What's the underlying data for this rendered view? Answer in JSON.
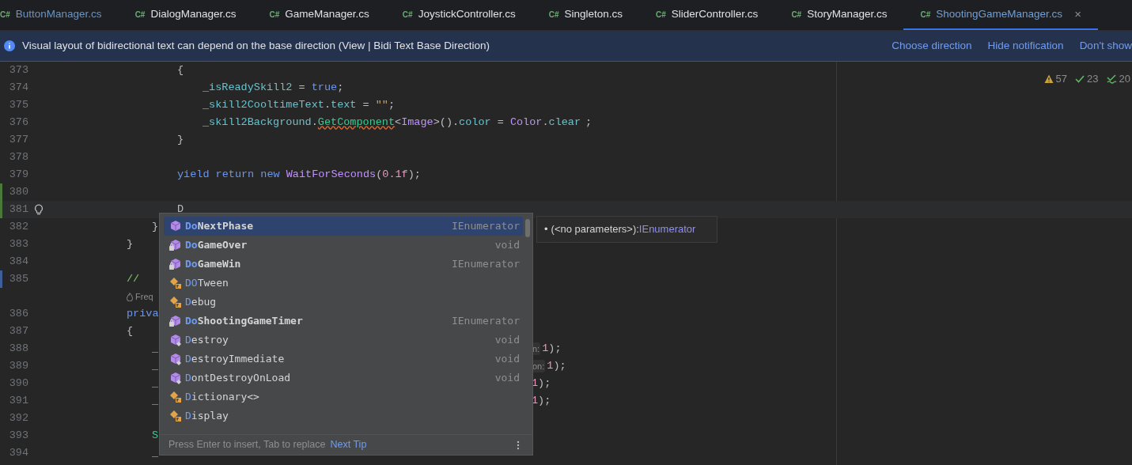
{
  "tabs": [
    {
      "lang": "C#",
      "label": "ButtonManager.cs",
      "color": "#6b93c4",
      "selected": false
    },
    {
      "lang": "C#",
      "label": "DialogManager.cs",
      "color": "#dfe1e5",
      "selected": false
    },
    {
      "lang": "C#",
      "label": "GameManager.cs",
      "color": "#dfe1e5",
      "selected": false
    },
    {
      "lang": "C#",
      "label": "JoystickController.cs",
      "color": "#dfe1e5",
      "selected": false
    },
    {
      "lang": "C#",
      "label": "Singleton.cs",
      "color": "#dfe1e5",
      "selected": false
    },
    {
      "lang": "C#",
      "label": "SliderController.cs",
      "color": "#dfe1e5",
      "selected": false
    },
    {
      "lang": "C#",
      "label": "StoryManager.cs",
      "color": "#dfe1e5",
      "selected": false
    },
    {
      "lang": "C#",
      "label": "ShootingGameManager.cs",
      "color": "#6f9fd6",
      "selected": true,
      "close": "×"
    }
  ],
  "notification": {
    "message": "Visual layout of bidirectional text can depend on the base direction (View | Bidi Text Base Direction)",
    "actions": [
      "Choose direction",
      "Hide notification",
      "Don't show"
    ]
  },
  "inspections": [
    {
      "kind": "warning",
      "count": "57"
    },
    {
      "kind": "check",
      "count": "23"
    },
    {
      "kind": "double-check",
      "count": "20"
    }
  ],
  "lines": [
    {
      "number": "373",
      "left": [
        {
          "kind": "code",
          "tokens": [
            {
              "text": "{",
              "kind": "plain"
            }
          ]
        }
      ]
    },
    {
      "number": "374",
      "left": [
        {
          "kind": "code",
          "tokens": [
            {
              "text": "_isReadySkill2",
              "kind": "field"
            },
            {
              "text": " = ",
              "kind": "plain"
            },
            {
              "text": "true",
              "kind": "keyword"
            },
            {
              "text": ";",
              "kind": "plain"
            }
          ]
        }
      ]
    },
    {
      "number": "375",
      "left": [
        {
          "kind": "code",
          "tokens": [
            {
              "text": "_skill2CooltimeText",
              "kind": "field"
            },
            {
              "text": ".",
              "kind": "plain"
            },
            {
              "text": "text",
              "kind": "field"
            },
            {
              "text": " = ",
              "kind": "plain"
            },
            {
              "text": "\"\"",
              "kind": "string"
            },
            {
              "text": ";",
              "kind": "plain"
            }
          ]
        }
      ]
    },
    {
      "number": "376",
      "left": [
        {
          "kind": "code",
          "tokens": [
            {
              "text": "_skill2Background",
              "kind": "field"
            },
            {
              "text": ".",
              "kind": "plain"
            },
            {
              "text": "GetComponent",
              "kind": "method-warn"
            },
            {
              "text": "<",
              "kind": "plain"
            },
            {
              "text": "Image",
              "kind": "class"
            },
            {
              "text": ">().",
              "kind": "plain"
            },
            {
              "text": "color",
              "kind": "field"
            },
            {
              "text": " = ",
              "kind": "plain"
            },
            {
              "text": "Color",
              "kind": "class"
            },
            {
              "text": ".",
              "kind": "plain"
            },
            {
              "text": "clear",
              "kind": "field"
            }
          ]
        },
        {
          "kind": "swatch"
        },
        {
          "kind": "code",
          "tokens": [
            {
              "text": ";",
              "kind": "plain"
            }
          ]
        }
      ]
    },
    {
      "number": "377",
      "left": [
        {
          "kind": "code",
          "tokens": [
            {
              "text": "}",
              "kind": "plain"
            }
          ]
        }
      ]
    },
    {
      "number": "378"
    },
    {
      "number": "379",
      "left": [
        {
          "kind": "code",
          "tokens": [
            {
              "text": "yield",
              "kind": "keyword"
            },
            {
              "text": " return",
              "kind": "keyword"
            },
            {
              "text": " new",
              "kind": "keyword"
            },
            {
              "text": " WaitForSeconds",
              "kind": "class"
            },
            {
              "text": "(",
              "kind": "plain"
            },
            {
              "text": "0.1f",
              "kind": "number"
            },
            {
              "text": ");",
              "kind": "plain"
            }
          ]
        }
      ]
    },
    {
      "number": "380",
      "added": true
    },
    {
      "number": "381",
      "added": true,
      "current": true,
      "bulb": true,
      "left": [
        {
          "kind": "code",
          "tokens": [
            {
              "text": "D",
              "kind": "plain"
            }
          ]
        }
      ]
    },
    {
      "number": "382",
      "left": [
        {
          "kind": "code",
          "tokens": [
            {
              "text": "}",
              "kind": "plain"
            }
          ]
        }
      ]
    },
    {
      "number": "383",
      "left": [
        {
          "kind": "code",
          "tokens": [
            {
              "text": "}",
              "kind": "plain"
            }
          ]
        }
      ]
    },
    {
      "number": "384"
    },
    {
      "number": "385",
      "modified": true,
      "left": [
        {
          "kind": "code",
          "tokens": [
            {
              "text": "//",
              "kind": "comment"
            }
          ]
        }
      ]
    },
    {
      "kind": "codelens",
      "text": "Freq"
    },
    {
      "number": "386",
      "left": [
        {
          "kind": "code",
          "tokens": [
            {
              "text": "priva",
              "kind": "keyword"
            }
          ]
        }
      ]
    },
    {
      "number": "387",
      "left": [
        {
          "kind": "code",
          "tokens": [
            {
              "text": "{",
              "kind": "plain"
            }
          ]
        }
      ]
    },
    {
      "number": "388",
      "left": [
        {
          "kind": "code",
          "tokens": [
            {
              "text": "_",
              "kind": "field"
            }
          ]
        }
      ],
      "right": [
        {
          "kind": "hint",
          "text": "n:"
        },
        {
          "kind": "code",
          "tokens": [
            {
              "text": "1",
              "kind": "number"
            },
            {
              "text": ");",
              "kind": "plain"
            }
          ]
        }
      ]
    },
    {
      "number": "389",
      "left": [
        {
          "kind": "code",
          "tokens": [
            {
              "text": "_",
              "kind": "field"
            }
          ]
        }
      ],
      "right": [
        {
          "kind": "hint",
          "text": "on:"
        },
        {
          "kind": "code",
          "tokens": [
            {
              "text": "1",
              "kind": "number"
            },
            {
              "text": ");",
              "kind": "plain"
            }
          ]
        }
      ]
    },
    {
      "number": "390",
      "left": [
        {
          "kind": "code",
          "tokens": [
            {
              "text": "_",
              "kind": "field"
            }
          ]
        }
      ],
      "right": [
        {
          "kind": "code",
          "tokens": [
            {
              "text": "1",
              "kind": "number"
            },
            {
              "text": ");",
              "kind": "plain"
            }
          ]
        }
      ]
    },
    {
      "number": "391",
      "left": [
        {
          "kind": "code",
          "tokens": [
            {
              "text": "_",
              "kind": "field"
            }
          ]
        }
      ],
      "right": [
        {
          "kind": "code",
          "tokens": [
            {
              "text": "1",
              "kind": "number"
            },
            {
              "text": ");",
              "kind": "plain"
            }
          ]
        }
      ]
    },
    {
      "number": "392"
    },
    {
      "number": "393",
      "left": [
        {
          "kind": "code",
          "tokens": [
            {
              "text": "S",
              "kind": "method"
            }
          ]
        }
      ]
    },
    {
      "number": "394",
      "left": [
        {
          "kind": "code",
          "tokens": [
            {
              "text": "_",
              "kind": "field"
            }
          ]
        }
      ]
    }
  ],
  "completion": {
    "items": [
      {
        "kind": "method",
        "match": "Do",
        "rest": "NextPhase",
        "bold": true,
        "type": "IEnumerator",
        "selected": true
      },
      {
        "kind": "private-method",
        "match": "Do",
        "rest": "GameOver",
        "bold": true,
        "type": "void",
        "selected": false
      },
      {
        "kind": "private-method",
        "match": "Do",
        "rest": "GameWin",
        "bold": true,
        "type": "IEnumerator",
        "selected": false
      },
      {
        "kind": "class",
        "match": "DO",
        "rest": "Tween",
        "bold": false,
        "selected": false
      },
      {
        "kind": "class",
        "match": "D",
        "rest": "ebug",
        "bold": false,
        "selected": false
      },
      {
        "kind": "private-method",
        "match": "Do",
        "rest": "ShootingGameTimer",
        "bold": true,
        "type": "IEnumerator",
        "selected": false
      },
      {
        "kind": "inherited-method",
        "match": "D",
        "rest": "estroy",
        "bold": false,
        "type": "void",
        "selected": false
      },
      {
        "kind": "inherited-method",
        "match": "D",
        "rest": "estroyImmediate",
        "bold": false,
        "type": "void",
        "selected": false
      },
      {
        "kind": "inherited-method",
        "match": "D",
        "rest": "ontDestroyOnLoad",
        "bold": false,
        "type": "void",
        "selected": false
      },
      {
        "kind": "class",
        "match": "D",
        "rest": "ictionary<>",
        "bold": false,
        "selected": false
      },
      {
        "kind": "class",
        "match": "D",
        "rest": "isplay",
        "bold": false,
        "selected": false
      }
    ],
    "footer": {
      "hint": "Press Enter to insert, Tab to replace",
      "link": "Next Tip"
    }
  },
  "parameter_info": {
    "bullet": "•",
    "signature": "(<no parameters>):",
    "return_type": "IEnumerator"
  }
}
